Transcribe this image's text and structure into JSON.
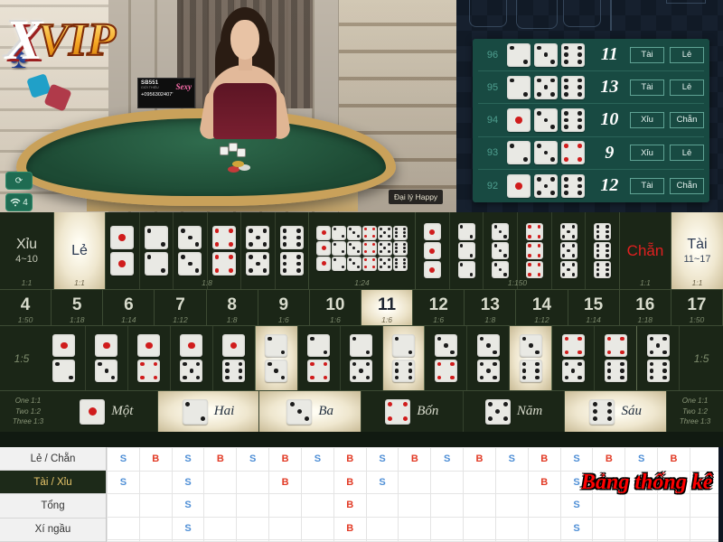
{
  "brand": {
    "x": "X",
    "vip": "VIP"
  },
  "stream": {
    "dealer_tag": "Đại lý Happy",
    "overlay": {
      "id": "SB551",
      "sub": "GIỚI THIỆU",
      "phone": "+0956302407'",
      "watermark": "Sexy"
    },
    "controls": [
      {
        "name": "refresh",
        "icon": "⟳",
        "label": ""
      },
      {
        "name": "signal",
        "icon": "⌃",
        "label": "4"
      }
    ]
  },
  "history": {
    "rows": [
      {
        "no": "96",
        "dice": [
          2,
          3,
          6
        ],
        "red": [
          false,
          false,
          false
        ],
        "total": "11",
        "tags": [
          "Tài",
          "Lẻ"
        ]
      },
      {
        "no": "95",
        "dice": [
          2,
          5,
          6
        ],
        "red": [
          false,
          false,
          false
        ],
        "total": "13",
        "tags": [
          "Tài",
          "Lẻ"
        ]
      },
      {
        "no": "94",
        "dice": [
          1,
          3,
          6
        ],
        "red": [
          true,
          false,
          false
        ],
        "total": "10",
        "tags": [
          "Xỉu",
          "Chẵn"
        ]
      },
      {
        "no": "93",
        "dice": [
          2,
          3,
          4
        ],
        "red": [
          false,
          false,
          true
        ],
        "total": "9",
        "tags": [
          "Xỉu",
          "Lẻ"
        ]
      },
      {
        "no": "92",
        "dice": [
          1,
          5,
          6
        ],
        "red": [
          true,
          false,
          false
        ],
        "total": "12",
        "tags": [
          "Tài",
          "Chẵn"
        ]
      }
    ]
  },
  "board": {
    "xiu": {
      "label": "Xỉu",
      "range": "4~10",
      "odds": "1:1",
      "lit": false
    },
    "le": {
      "label": "Lẻ",
      "odds": "1:1",
      "lit": true
    },
    "doubles": {
      "odds": "1:8",
      "faces": [
        1,
        2,
        3,
        4,
        5,
        6
      ],
      "red": [
        true,
        false,
        false,
        true,
        false,
        false
      ]
    },
    "any_triple": {
      "odds": "1:24",
      "faces": [
        1,
        2,
        3,
        4,
        5,
        6
      ],
      "red": [
        true,
        false,
        false,
        true,
        false,
        false
      ]
    },
    "triples": {
      "odds": "1:150",
      "faces": [
        1,
        2,
        3,
        4,
        5,
        6
      ],
      "red": [
        true,
        false,
        false,
        true,
        false,
        false
      ]
    },
    "chan": {
      "label": "Chẵn",
      "odds": "1:1",
      "lit": false
    },
    "tai": {
      "label": "Tài",
      "range": "11~17",
      "odds": "1:1",
      "lit": true
    },
    "totals": [
      {
        "n": "4",
        "odds": "1:50",
        "lit": false
      },
      {
        "n": "5",
        "odds": "1:18",
        "lit": false
      },
      {
        "n": "6",
        "odds": "1:14",
        "lit": false
      },
      {
        "n": "7",
        "odds": "1:12",
        "lit": false
      },
      {
        "n": "8",
        "odds": "1:8",
        "lit": false
      },
      {
        "n": "9",
        "odds": "1:6",
        "lit": false
      },
      {
        "n": "10",
        "odds": "1:6",
        "lit": false
      },
      {
        "n": "11",
        "odds": "1:6",
        "lit": true
      },
      {
        "n": "12",
        "odds": "1:6",
        "lit": false
      },
      {
        "n": "13",
        "odds": "1:8",
        "lit": false
      },
      {
        "n": "14",
        "odds": "1:12",
        "lit": false
      },
      {
        "n": "15",
        "odds": "1:14",
        "lit": false
      },
      {
        "n": "16",
        "odds": "1:18",
        "lit": false
      },
      {
        "n": "17",
        "odds": "1:50",
        "lit": false
      }
    ],
    "pairs_odds_left": "1:5",
    "pairs_odds_right": "1:5",
    "pairs": [
      {
        "a": 1,
        "b": 2,
        "ar": true,
        "br": false,
        "lit": false,
        "grp": false
      },
      {
        "a": 1,
        "b": 3,
        "ar": true,
        "br": false,
        "lit": false,
        "grp": false
      },
      {
        "a": 1,
        "b": 4,
        "ar": true,
        "br": true,
        "lit": false,
        "grp": false
      },
      {
        "a": 1,
        "b": 5,
        "ar": true,
        "br": false,
        "lit": false,
        "grp": false
      },
      {
        "a": 1,
        "b": 6,
        "ar": true,
        "br": false,
        "lit": false,
        "grp": true
      },
      {
        "a": 2,
        "b": 3,
        "ar": false,
        "br": false,
        "lit": true,
        "grp": false
      },
      {
        "a": 2,
        "b": 4,
        "ar": false,
        "br": true,
        "lit": false,
        "grp": false
      },
      {
        "a": 2,
        "b": 5,
        "ar": false,
        "br": false,
        "lit": false,
        "grp": false
      },
      {
        "a": 2,
        "b": 6,
        "ar": false,
        "br": false,
        "lit": true,
        "grp": true
      },
      {
        "a": 3,
        "b": 4,
        "ar": false,
        "br": true,
        "lit": false,
        "grp": false
      },
      {
        "a": 3,
        "b": 5,
        "ar": false,
        "br": false,
        "lit": false,
        "grp": false
      },
      {
        "a": 3,
        "b": 6,
        "ar": false,
        "br": false,
        "lit": true,
        "grp": true
      },
      {
        "a": 4,
        "b": 5,
        "ar": true,
        "br": false,
        "lit": false,
        "grp": false
      },
      {
        "a": 4,
        "b": 6,
        "ar": true,
        "br": false,
        "lit": false,
        "grp": true
      },
      {
        "a": 5,
        "b": 6,
        "ar": false,
        "br": false,
        "lit": false,
        "grp": false
      }
    ],
    "singles_legend": [
      "One 1:1",
      "Two 1:2",
      "Three 1:3"
    ],
    "singles": [
      {
        "face": 1,
        "label": "Một",
        "red": true,
        "lit": false
      },
      {
        "face": 2,
        "label": "Hai",
        "red": false,
        "lit": true
      },
      {
        "face": 3,
        "label": "Ba",
        "red": false,
        "lit": true
      },
      {
        "face": 4,
        "label": "Bốn",
        "red": true,
        "lit": false
      },
      {
        "face": 5,
        "label": "Năm",
        "red": false,
        "lit": false
      },
      {
        "face": 6,
        "label": "Sáu",
        "red": false,
        "lit": true
      }
    ]
  },
  "stats": {
    "title": "Bảng thống kê",
    "tabs": [
      {
        "label": "Lẻ / Chẵn",
        "active": false
      },
      {
        "label": "Tài / Xỉu",
        "active": true
      },
      {
        "label": "Tổng",
        "active": false
      },
      {
        "label": "Xí ngầu",
        "active": false
      }
    ],
    "columns": 19,
    "rows": 4,
    "grid": [
      [
        "S",
        "B",
        "S",
        "B",
        "S",
        "B",
        "S",
        "B",
        "S",
        "B",
        "S",
        "B",
        "S",
        "B",
        "S",
        "B",
        "S",
        "B",
        ""
      ],
      [
        "S",
        "",
        "S",
        "",
        "",
        "B",
        "",
        "B",
        "S",
        "",
        "",
        "",
        "",
        "B",
        "S",
        "",
        "S",
        "B",
        ""
      ],
      [
        "",
        "",
        "S",
        "",
        "",
        "",
        "",
        "B",
        "",
        "",
        "",
        "",
        "",
        "",
        "S",
        "",
        "",
        "",
        ""
      ],
      [
        "",
        "",
        "S",
        "",
        "",
        "",
        "",
        "B",
        "",
        "",
        "",
        "",
        "",
        "",
        "S",
        "",
        "",
        "",
        ""
      ]
    ]
  }
}
